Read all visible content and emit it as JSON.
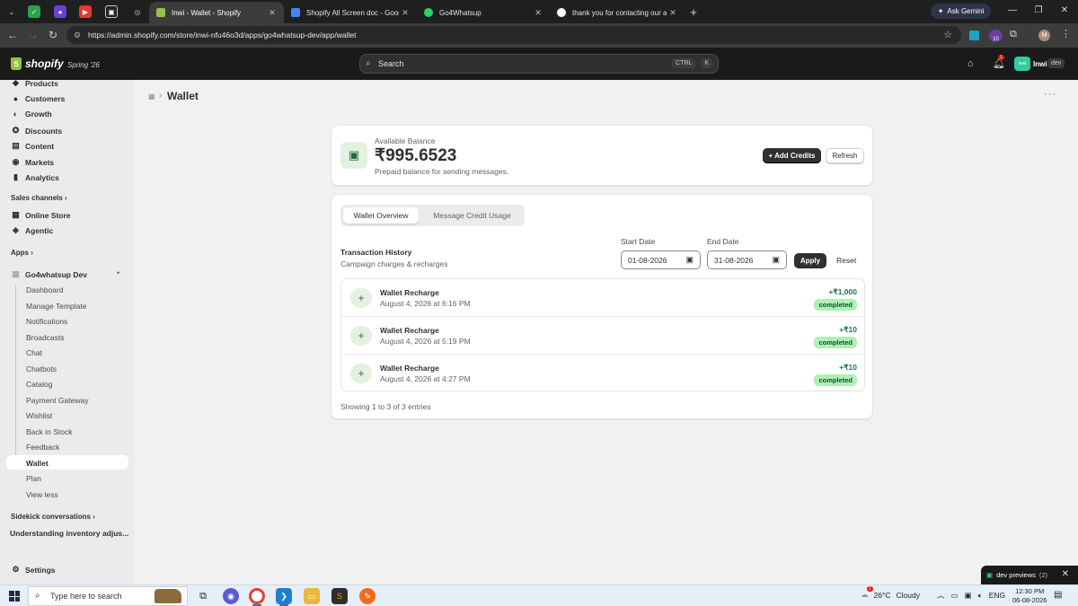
{
  "browser": {
    "tabs": [
      {
        "title": "Inwi - Wallet - Shopify",
        "active": true
      },
      {
        "title": "Shopify All Screen doc - Google",
        "active": false
      },
      {
        "title": "Go4Whatsup",
        "active": false
      },
      {
        "title": "thank you for contacting our ap",
        "active": false
      }
    ],
    "new_tab": "+",
    "ask_gemini": "Ask Gemini",
    "url": "https://admin.shopify.com/store/inwi-nfu46o3d/apps/go4whatsup-dev/app/wallet",
    "extension_badge": "10",
    "profile_initial": "M"
  },
  "topbar": {
    "brand": "shopify",
    "edition": "Spring '26",
    "search_placeholder": "Search",
    "shortcut_key1": "CTRL",
    "shortcut_key2": "K",
    "notif_count": "1",
    "store_avatar": "inwi",
    "store_name": "Inwi",
    "store_badge": "dev"
  },
  "sidebar": {
    "main_items": [
      {
        "label": "Products",
        "icon": "tag-icon"
      },
      {
        "label": "Customers",
        "icon": "person-icon"
      },
      {
        "label": "Growth",
        "icon": "growth-icon"
      },
      {
        "label": "Discounts",
        "icon": "discount-icon"
      },
      {
        "label": "Content",
        "icon": "content-icon"
      },
      {
        "label": "Markets",
        "icon": "globe-icon"
      },
      {
        "label": "Analytics",
        "icon": "chart-icon"
      }
    ],
    "sales_channels_label": "Sales channels",
    "channels": [
      {
        "label": "Online Store"
      },
      {
        "label": "Agentic"
      }
    ],
    "apps_label": "Apps",
    "app_name": "Go4whatsup Dev",
    "app_sub_items": [
      "Dashboard",
      "Manage Template",
      "Notifications",
      "Broadcasts",
      "Chat",
      "Chatbots",
      "Catalog",
      "Payment Gateway",
      "Wishlist",
      "Back in Stock",
      "Feedback",
      "Wallet",
      "Plan",
      "View less"
    ],
    "sidekick_label": "Sidekick conversations",
    "sidekick_item": "Understanding inventory adjus...",
    "settings_label": "Settings"
  },
  "page": {
    "title": "Wallet"
  },
  "balance": {
    "label": "Available Balance",
    "amount": "₹995.6523",
    "description": "Prepaid balance for sending messages.",
    "add_credits": "+ Add Credits",
    "refresh": "Refresh"
  },
  "history": {
    "tabs": [
      "Wallet Overview",
      "Message Credit Usage"
    ],
    "title": "Transaction History",
    "subtitle": "Campaign charges & recharges",
    "start_label": "Start Date",
    "start_value": "01-08-2026",
    "end_label": "End Date",
    "end_value": "31-08-2026",
    "apply": "Apply",
    "reset": "Reset",
    "transactions": [
      {
        "title": "Wallet Recharge",
        "date": "August 4, 2026 at 6:16 PM",
        "amount": "+₹1,000",
        "status": "completed"
      },
      {
        "title": "Wallet Recharge",
        "date": "August 4, 2026 at 5:19 PM",
        "amount": "+₹10",
        "status": "completed"
      },
      {
        "title": "Wallet Recharge",
        "date": "August 4, 2026 at 4:27 PM",
        "amount": "+₹10",
        "status": "completed"
      }
    ],
    "showing": "Showing 1 to 3 of 3 entries"
  },
  "dev_previews": {
    "label": "dev previews",
    "count": "(2)"
  },
  "taskbar": {
    "search_placeholder": "Type here to search",
    "weather_temp": "26°C",
    "weather_desc": "Cloudy",
    "weather_badge": "2",
    "lang": "ENG",
    "time": "12:30 PM",
    "date": "06-08-2026"
  },
  "colors": {
    "accent_dark": "#303030",
    "success_green": "#1a7a45",
    "badge_bg": "#aff0b5",
    "shopify_green": "#95bf47"
  }
}
